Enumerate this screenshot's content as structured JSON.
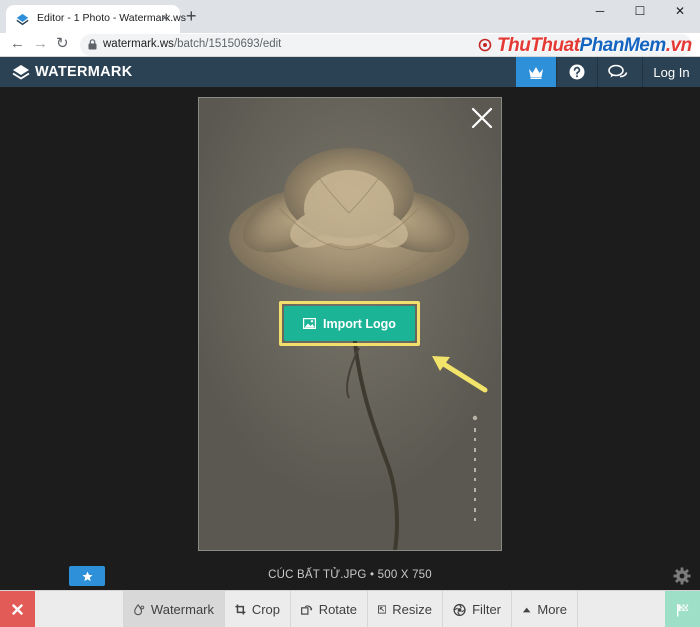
{
  "browser": {
    "tab_title": "Editor - 1 Photo - Watermark.ws",
    "tab_close": "×",
    "new_tab": "+",
    "url_host": "watermark.ws",
    "url_path": "/batch/15150693/edit",
    "window_controls": {
      "minimize": "─",
      "maximize": "☐",
      "close": "✕"
    },
    "nav": {
      "back": "←",
      "forward": "→",
      "reload": "↻"
    },
    "brand_overlay_part1": "ThuThuat",
    "brand_overlay_part2": "PhanMem",
    "brand_overlay_part3": ".vn"
  },
  "header": {
    "logo_text": "WATERMARK",
    "login_label": "Log In",
    "icons": [
      "crown-icon",
      "help-icon",
      "chat-icon"
    ],
    "accent": "#2e90d8",
    "background": "#2b4255"
  },
  "editor": {
    "import_logo_label": "Import Logo",
    "file_name": "CÚC BẤT TỬ.JPG",
    "file_separator": "•",
    "file_dimensions": "500 X 750",
    "import_color": "#1bb497",
    "highlight_color": "#f5df6c"
  },
  "toolbar": {
    "tools": [
      {
        "label": "Watermark",
        "icon": "droplet-icon",
        "active": true
      },
      {
        "label": "Crop",
        "icon": "crop-icon",
        "active": false
      },
      {
        "label": "Rotate",
        "icon": "rotate-icon",
        "active": false
      },
      {
        "label": "Resize",
        "icon": "resize-icon",
        "active": false
      },
      {
        "label": "Filter",
        "icon": "filter-icon",
        "active": false
      },
      {
        "label": "More",
        "icon": "caret-up-icon",
        "active": false
      }
    ],
    "cancel_color": "#e25b57",
    "finish_color": "#9ee0c7"
  }
}
